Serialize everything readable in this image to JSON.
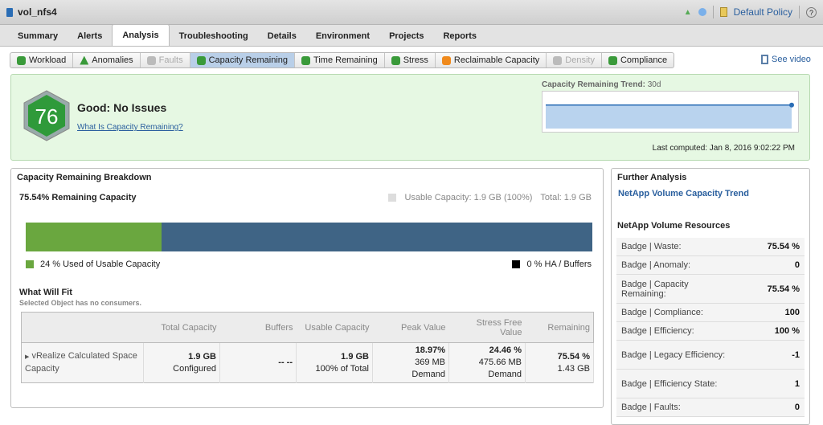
{
  "window": {
    "title": "vol_nfs4",
    "policy": "Default Policy",
    "help": "?"
  },
  "tabs": [
    {
      "label": "Summary"
    },
    {
      "label": "Alerts"
    },
    {
      "label": "Analysis",
      "active": true
    },
    {
      "label": "Troubleshooting"
    },
    {
      "label": "Details"
    },
    {
      "label": "Environment"
    },
    {
      "label": "Projects"
    },
    {
      "label": "Reports"
    }
  ],
  "badges": [
    {
      "label": "Workload",
      "icon": "workload-icon",
      "color": "#3a9a3a"
    },
    {
      "label": "Anomalies",
      "icon": "anomalies-icon",
      "color": "#3a9a3a"
    },
    {
      "label": "Faults",
      "icon": "faults-icon",
      "color": "#bbbbbb",
      "disabled": true
    },
    {
      "label": "Capacity Remaining",
      "icon": "capacity-remaining-icon",
      "color": "#3a9a3a",
      "selected": true
    },
    {
      "label": "Time Remaining",
      "icon": "time-remaining-icon",
      "color": "#3a9a3a"
    },
    {
      "label": "Stress",
      "icon": "stress-icon",
      "color": "#3a9a3a"
    },
    {
      "label": "Reclaimable Capacity",
      "icon": "reclaimable-capacity-icon",
      "color": "#f08a1c"
    },
    {
      "label": "Density",
      "icon": "density-icon",
      "color": "#bbbbbb",
      "disabled": true
    },
    {
      "label": "Compliance",
      "icon": "compliance-icon",
      "color": "#3a9a3a"
    }
  ],
  "see_video": "See video",
  "summary": {
    "score": "76",
    "status": "Good: No Issues",
    "help_link": "What Is Capacity Remaining?",
    "trend_label": "Capacity Remaining Trend:",
    "trend_period": "30d",
    "last_computed": "Last computed: Jan 8, 2016 9:02:22 PM"
  },
  "chart_data": {
    "type": "area",
    "title": "Capacity Remaining Trend: 30d",
    "values": [
      75.54,
      75.54
    ],
    "ylim": [
      0,
      100
    ],
    "grid": false
  },
  "breakdown": {
    "title": "Capacity Remaining Breakdown",
    "remaining": "75.54% Remaining Capacity",
    "usable": "Usable Capacity: 1.9 GB (100%)",
    "total": "Total: 1.9 GB",
    "used_fraction": 0.24,
    "used_color": "#6aa73f",
    "remaining_color": "#3f6485",
    "used_legend": "24 % Used of Usable Capacity",
    "ha_legend": "0 % HA / Buffers"
  },
  "fit": {
    "title": "What Will Fit",
    "subtitle": "Selected Object has no consumers.",
    "headers": [
      "",
      "Total Capacity",
      "Buffers",
      "Usable Capacity",
      "Peak Value",
      "Stress Free Value",
      "Remaining"
    ],
    "row": {
      "name": "vRealize Calculated Space Capacity",
      "total": "1.9 GB",
      "total_sub": "Configured",
      "buffers": "-- --",
      "usable": "1.9 GB",
      "usable_sub": "100% of Total",
      "peak": "18.97%",
      "peak_mb": "369 MB",
      "peak_sub": "Demand",
      "stress": "24.46 %",
      "stress_mb": "475.66 MB",
      "stress_sub": "Demand",
      "remaining": "75.54 %",
      "remaining_gb": "1.43 GB"
    }
  },
  "further": {
    "title": "Further Analysis",
    "link": "NetApp Volume Capacity Trend",
    "resources_title": "NetApp Volume Resources",
    "rows": [
      {
        "label": "Badge | Waste:",
        "value": "75.54 %"
      },
      {
        "label": "Badge | Anomaly:",
        "value": "0"
      },
      {
        "label": "Badge | Capacity Remaining:",
        "value": "75.54 %"
      },
      {
        "label": "Badge | Compliance:",
        "value": "100"
      },
      {
        "label": "Badge | Efficiency:",
        "value": "100 %"
      },
      {
        "label": "Badge | Legacy Efficiency:",
        "value": "-1"
      },
      {
        "label": "Badge | Efficiency State:",
        "value": "1"
      },
      {
        "label": "Badge | Faults:",
        "value": "0"
      }
    ]
  }
}
